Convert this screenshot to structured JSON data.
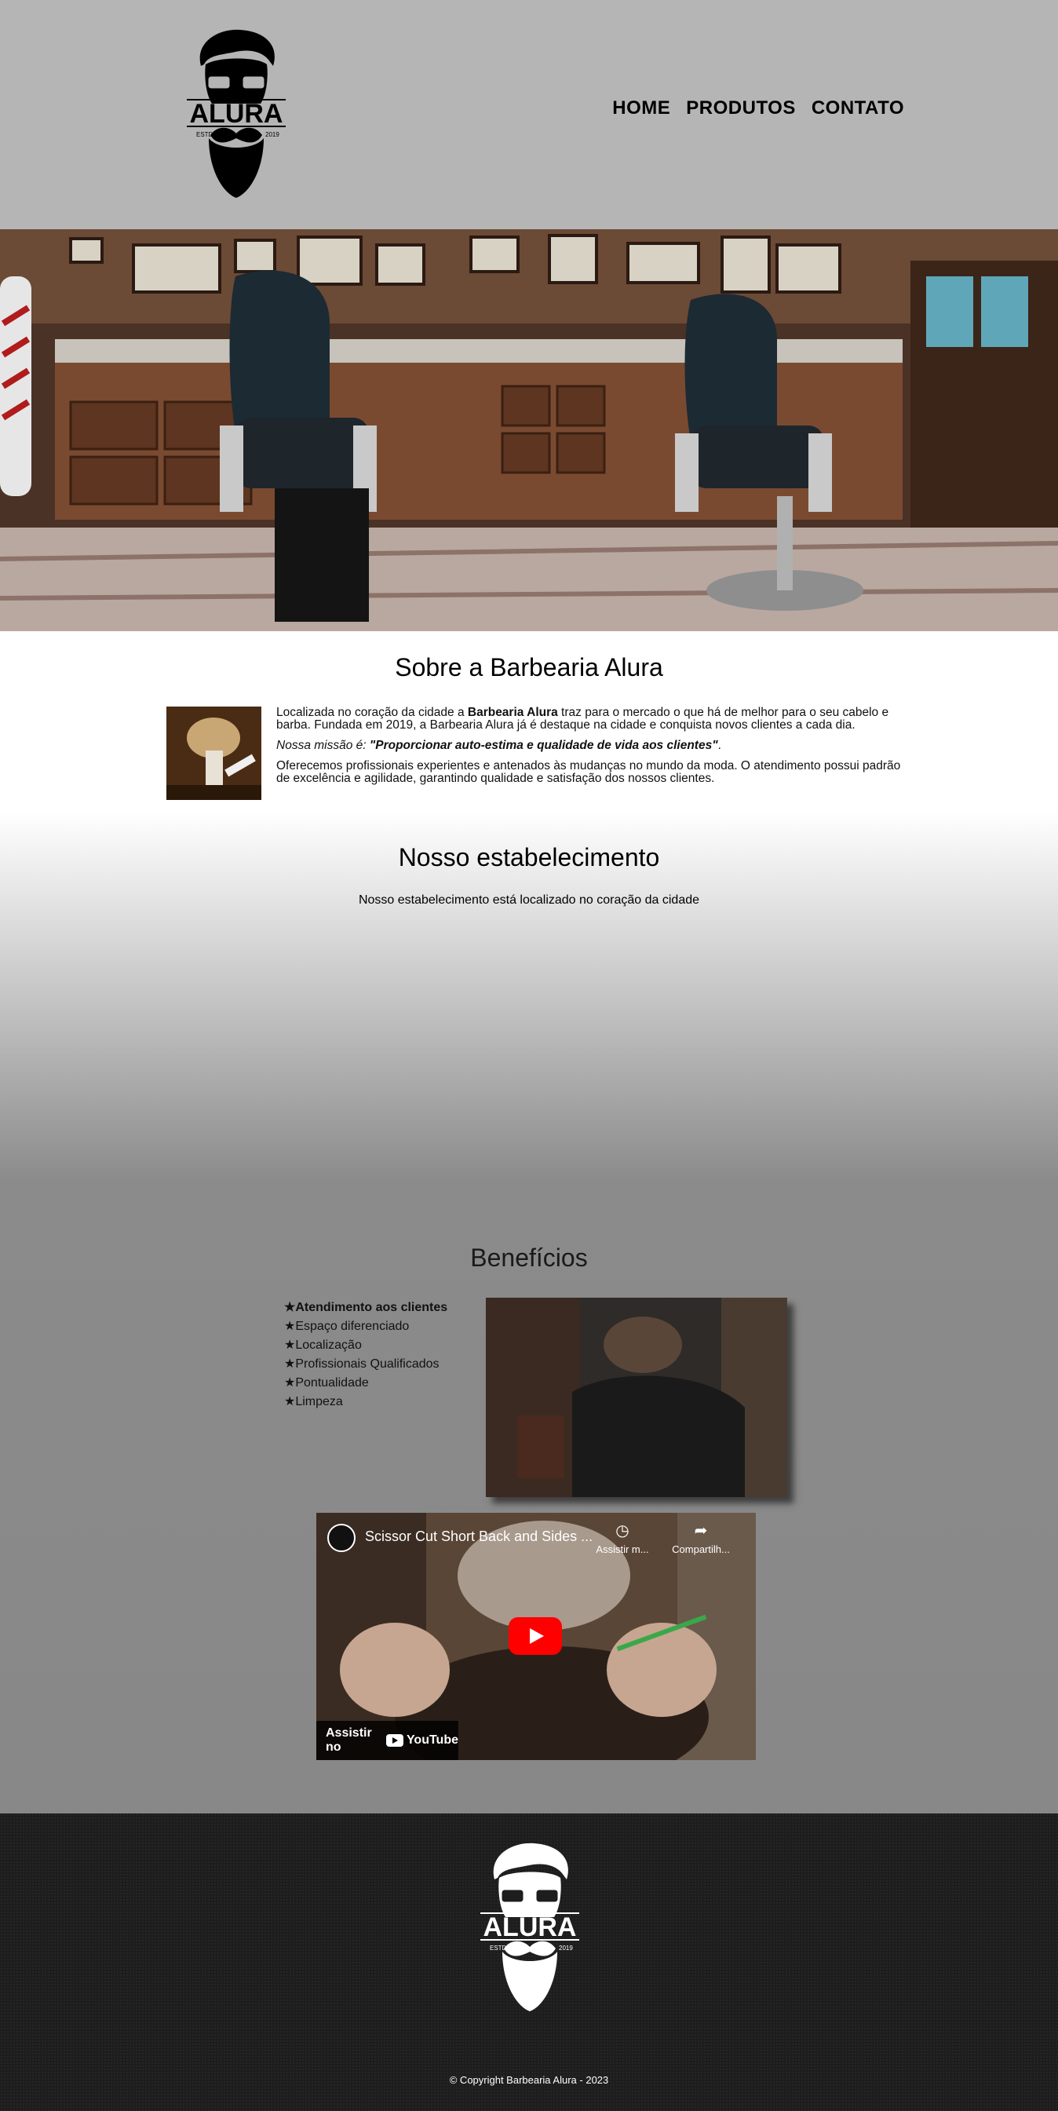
{
  "header": {
    "logo": {
      "brand": "ALURA",
      "estd": "ESTD",
      "year": "2019"
    },
    "nav": [
      {
        "label": "HOME"
      },
      {
        "label": "PRODUTOS"
      },
      {
        "label": "CONTATO"
      }
    ]
  },
  "sobre": {
    "title": "Sobre a Barbearia Alura",
    "p1_before": "Localizada no coração da cidade a ",
    "p1_strong": "Barbearia Alura",
    "p1_after": " traz para o mercado o que há de melhor para o seu cabelo e barba. Fundada em 2019, a Barbearia Alura já é destaque na cidade e conquista novos clientes a cada dia.",
    "p2_em": "Nossa missão é: ",
    "p2_strong": "\"Proporcionar auto-estima e qualidade de vida aos clientes\"",
    "p2_end": ".",
    "p3": "Oferecemos profissionais experientes e antenados às mudanças no mundo da moda. O atendimento possui padrão de excelência e agilidade, garantindo qualidade e satisfação dos nossos clientes."
  },
  "estabelecimento": {
    "title": "Nosso estabelecimento",
    "text": "Nosso estabelecimento está localizado no coração da cidade"
  },
  "beneficios": {
    "title": "Benefícios",
    "items": [
      "Atendimento aos clientes",
      "Espaço diferenciado",
      "Localização",
      "Profissionais Qualificados",
      "Pontualidade",
      "Limpeza"
    ]
  },
  "video": {
    "title": "Scissor Cut Short Back and Sides ...",
    "watch_later": "Assistir m...",
    "share": "Compartilh...",
    "watch_on": "Assistir no",
    "youtube": "YouTube"
  },
  "footer": {
    "logo": {
      "brand": "ALURA",
      "estd": "ESTD",
      "year": "2019"
    },
    "copyright": "© Copyright Barbearia Alura - 2023"
  },
  "colors": {
    "header_bg": "#b5b5b5",
    "footer_bg": "#1d1d1d",
    "play_button": "#ff0000"
  }
}
